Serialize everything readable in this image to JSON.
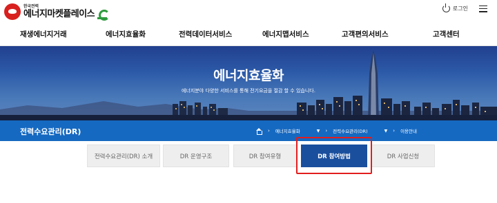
{
  "header": {
    "logo_small": "한국전력",
    "logo_main": "에너지마켓플레이스",
    "login_label": "로그인"
  },
  "gnb": {
    "items": [
      "재생에너지거래",
      "에너지효율화",
      "전력데이터서비스",
      "에너지맵서비스",
      "고객편의서비스",
      "고객센터"
    ]
  },
  "hero": {
    "title": "에너지효율화",
    "description": "에너지분야 다양한 서비스를 통해 전기요금을 절감 할 수 있습니다."
  },
  "subnav": {
    "title": "전력수요관리(DR)",
    "breadcrumbs": [
      "에너지효율화",
      "전력수요관리(DR)",
      "이용안내"
    ]
  },
  "tabs": {
    "items": [
      "전력수요관리(DR) 소개",
      "DR 운영구조",
      "DR 참여유형",
      "DR 참여방법",
      "DR 사업신청"
    ],
    "active": "DR 참여방법"
  },
  "colors": {
    "accent_blue": "#1669c1",
    "active_tab": "#1a4f9e",
    "highlight_red": "#e21d1d",
    "logo_red": "#d8201f",
    "logo_green": "#2e9b3e"
  }
}
